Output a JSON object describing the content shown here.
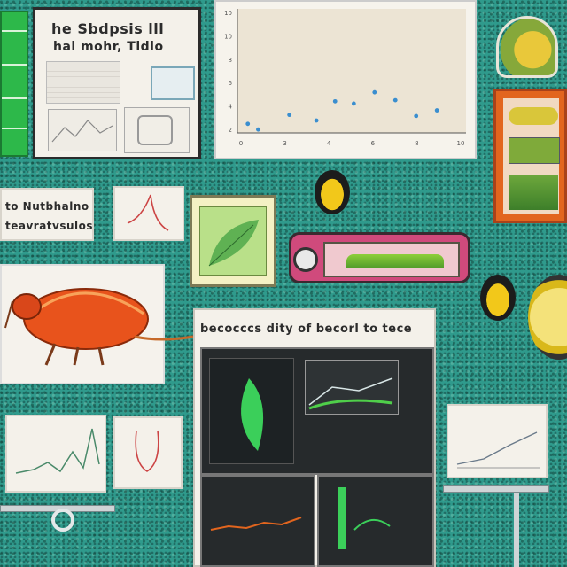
{
  "scatter_chart": {
    "y_ticks": [
      "10",
      "10",
      "8",
      "6",
      "4",
      "2"
    ],
    "x_ticks": [
      "0",
      "3",
      "4",
      "6",
      "8",
      "10"
    ],
    "points": [
      [
        0.5,
        0.8
      ],
      [
        1.0,
        0.3
      ],
      [
        2.5,
        1.6
      ],
      [
        3.8,
        1.1
      ],
      [
        4.7,
        2.8
      ],
      [
        5.6,
        2.6
      ],
      [
        6.6,
        3.6
      ],
      [
        7.6,
        2.9
      ],
      [
        8.6,
        1.5
      ],
      [
        9.6,
        2.0
      ]
    ],
    "xlim": [
      0,
      11
    ],
    "ylim": [
      0,
      11
    ],
    "point_color": "#3a8ecf",
    "background": "#ece4d4"
  },
  "top_notice": {
    "line1": "he Sbdpsis lll",
    "line2": "hal mohr, Tidio"
  },
  "side_label": {
    "line1": "to Nutbhalno",
    "line2": "teavratvsulos"
  },
  "main_panel": {
    "title": "becocccs dity of becorl to tece"
  },
  "colors": {
    "board": "#2f9a8c",
    "green_accent": "#2db84a",
    "orange_frame": "#e2651e",
    "insect": "#e8531c",
    "bee_yellow": "#f2c81a"
  },
  "icons": [
    "insect-illustration-icon",
    "bee-icon",
    "microscope-icon",
    "flask-icon"
  ]
}
